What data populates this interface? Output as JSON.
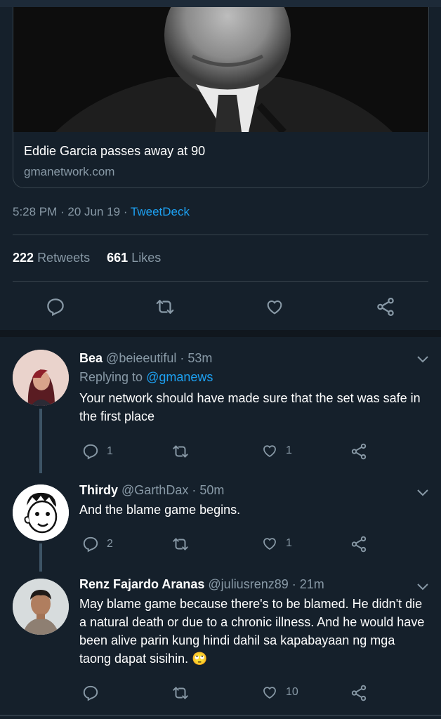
{
  "link_card": {
    "title": "Eddie Garcia passes away at 90",
    "domain": "gmanetwork.com"
  },
  "tweet_meta": {
    "time": "5:28 PM · 20 Jun 19 · ",
    "source": "TweetDeck"
  },
  "stats": {
    "retweets_count": "222",
    "retweets_label": "Retweets",
    "likes_count": "661",
    "likes_label": "Likes"
  },
  "colors": {
    "background": "#15202b",
    "accent": "#1da1f2",
    "secondary_text": "#8899a6",
    "divider": "#38444d"
  },
  "replies": [
    {
      "name": "Bea",
      "handle": "@beieeutiful",
      "time": " · 53m",
      "replying_to_label": "Replying to ",
      "replying_to": "@gmanews",
      "text": "Your network should have made sure that the set was safe in the first place",
      "reply_count": "1",
      "retweet_count": "",
      "like_count": "1"
    },
    {
      "name": "Thirdy",
      "handle": "@GarthDax",
      "time": " · 50m",
      "text": "And the blame game begins.",
      "reply_count": "2",
      "retweet_count": "",
      "like_count": "1"
    },
    {
      "name": "Renz Fajardo Aranas",
      "handle": "@juliusrenz89",
      "time": " · 21m",
      "text": "May blame game because there's to be blamed. He didn't die a natural death or due to a chronic illness. And he would have been alive parin kung hindi dahil sa kapabayaan ng mga taong dapat sisihin.",
      "emoji": "🙄",
      "reply_count": "",
      "retweet_count": "",
      "like_count": "10"
    }
  ],
  "icons": [
    "reply-icon",
    "retweet-icon",
    "like-icon",
    "share-icon",
    "chevron-down-icon"
  ]
}
